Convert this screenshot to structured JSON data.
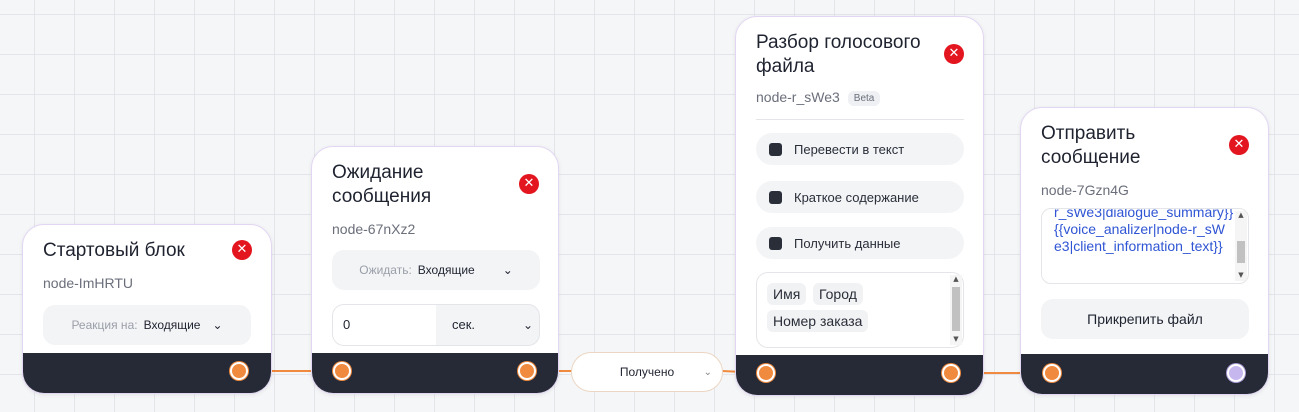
{
  "colors": {
    "port_orange": "#f08a3f",
    "port_purple": "#c6b8ef",
    "footer_dark": "#252a36",
    "close_red": "#e3151f",
    "template_link": "#2f55d4"
  },
  "nodes": {
    "start": {
      "title": "Стартовый блок",
      "id": "node-ImHRTU",
      "reaction_label": "Реакция на:",
      "reaction_value": "Входящие"
    },
    "wait": {
      "title_line1": "Ожидание",
      "title_line2": "сообщения",
      "id": "node-67nXz2",
      "wait_label": "Ожидать:",
      "wait_value": "Входящие",
      "timeout_value": "0",
      "timeout_unit": "сек."
    },
    "voice": {
      "title_line1": "Разбор голосового",
      "title_line2": "файла",
      "id": "node-r_sWe3",
      "badge": "Beta",
      "options": [
        "Перевести в текст",
        "Краткое содержание",
        "Получить данные"
      ],
      "tags": [
        "Имя",
        "Город",
        "Номер заказа"
      ]
    },
    "send": {
      "title_line1": "Отправить",
      "title_line2": "сообщение",
      "id": "node-7Gzn4G",
      "template_lines": [
        "r_sWe3|dialogue_summary}}",
        "{{voice_analizer|node-r_sWe3|client_information_text}}"
      ],
      "attach_label": "Прикрепить файл"
    }
  },
  "connector": {
    "label": "Получено"
  },
  "icons": {
    "close": "close-icon",
    "chevron": "chevron-down-icon"
  }
}
